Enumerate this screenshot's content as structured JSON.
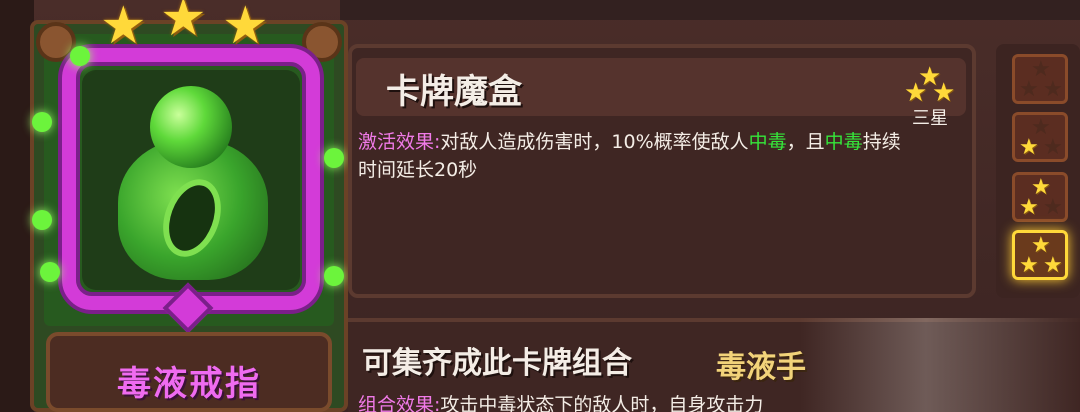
{
  "card": {
    "name": "毒液戒指",
    "stars": 3
  },
  "info": {
    "title": "卡牌魔盒",
    "star_label": "三星",
    "effect_label": "激活效果:",
    "effect_part1": "对敌人造成伤害时，10%概率使敌人",
    "effect_poison1": "中毒",
    "effect_part2": "，且",
    "effect_poison2": "中毒",
    "effect_part3": "持续",
    "effect_line2": "时间延长20秒"
  },
  "star_selector": {
    "options": [
      1,
      2,
      3,
      4
    ],
    "selected": 4
  },
  "combo": {
    "title": "可集齐成此卡牌组合",
    "set_name": "毒液手",
    "effect_label": "组合效果:",
    "effect_text": "攻击中毒状态下的敌人时，自身攻击力"
  },
  "colors": {
    "poison_green": "#35e63a",
    "label_pink": "#f07ae8",
    "star_gold": "#ffd93a",
    "ring_purple": "#d33bd8"
  }
}
